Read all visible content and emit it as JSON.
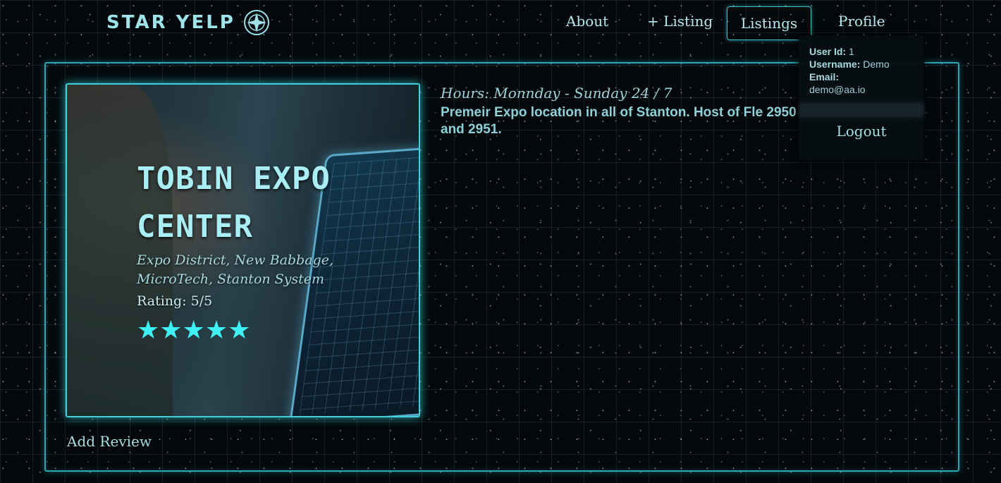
{
  "brand": {
    "name": "STAR YELP",
    "logo_icon": "star-emblem-icon"
  },
  "nav": {
    "about": "About",
    "add_listing": "+ Listing",
    "listings": "Listings",
    "profile": "Profile"
  },
  "listing": {
    "title": "TOBIN EXPO CENTER",
    "address": "Expo District, New Babbage, MicroTech, Stanton System",
    "rating_text": "Rating: 5/5",
    "stars": "★★★★★",
    "rating_value": 5,
    "hours": "Hours: Monnday - Sunday 24 / 7",
    "description": "Premeir Expo location in all of Stanton. Host of Fle 2950 and 2951."
  },
  "actions": {
    "add_review": "Add Review"
  },
  "profile_menu": {
    "user_id_label": "User Id:",
    "user_id": "1",
    "username_label": "Username:",
    "username": "Demo",
    "email_label": "Email:",
    "email": "demo@aa.io",
    "logout": "Logout"
  },
  "colors": {
    "accent": "#3fd0dc",
    "text": "#a8dde2",
    "background": "#04080b"
  }
}
